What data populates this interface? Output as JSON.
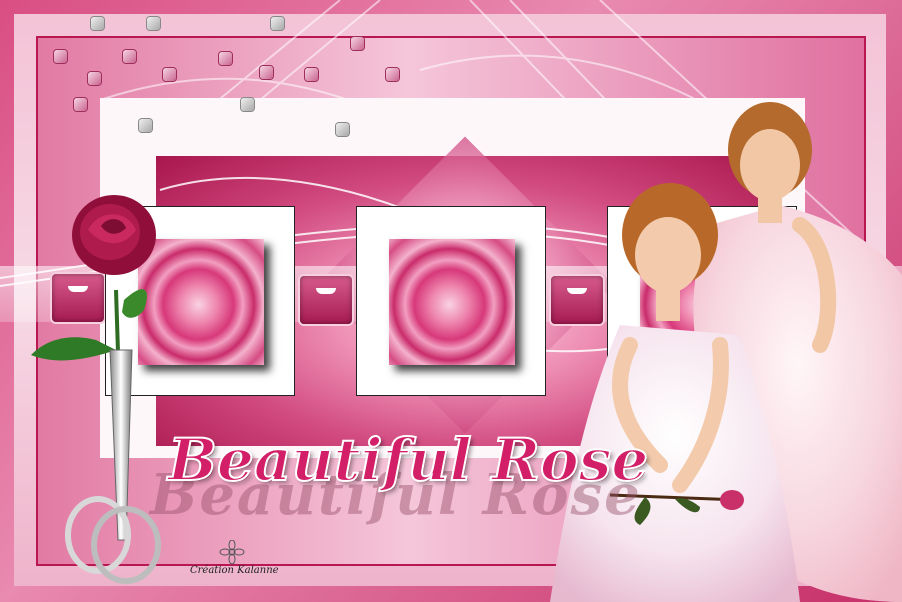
{
  "title": "Beautiful Rose",
  "title_shadow": "Beautiful Rose",
  "credit": "Création Kalanne",
  "colors": {
    "border": "#c21d58",
    "accent": "#d21f67",
    "frame": "#f5c6d9"
  }
}
